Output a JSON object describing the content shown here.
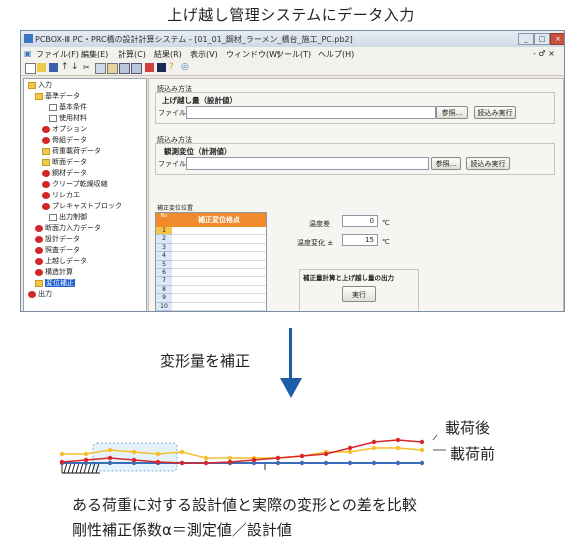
{
  "heading": "上げ越し管理システムにデータ入力",
  "window": {
    "title": "PCBOX-Ⅲ PC・PRC橋の設計計算システム - [01_01_鋼材_ラーメン_橋台_施工_PC.pb2]",
    "menus": [
      "ファイル(F)",
      "編集(E)",
      "計算(C)",
      "結果(R)",
      "表示(V)",
      "ウィンドウ(W)",
      "ツール(T)",
      "ヘルプ(H)"
    ],
    "menu_right": "- ♂ ×",
    "tree": [
      {
        "label": "入力",
        "icon": "folder",
        "level": 0
      },
      {
        "label": "基準データ",
        "icon": "folder",
        "level": 1
      },
      {
        "label": "基本条件",
        "icon": "doc",
        "level": 3
      },
      {
        "label": "使用材料",
        "icon": "doc",
        "level": 3
      },
      {
        "label": "オプション",
        "icon": "red",
        "level": 2
      },
      {
        "label": "骨組データ",
        "icon": "red",
        "level": 2
      },
      {
        "label": "荷重載荷データ",
        "icon": "folder",
        "level": 2
      },
      {
        "label": "断面データ",
        "icon": "folder",
        "level": 2
      },
      {
        "label": "鋼材データ",
        "icon": "red",
        "level": 2
      },
      {
        "label": "クリープ乾燥収縮",
        "icon": "red",
        "level": 2
      },
      {
        "label": "リレカエ",
        "icon": "red",
        "level": 2
      },
      {
        "label": "プレキャストブロック",
        "icon": "red",
        "level": 2
      },
      {
        "label": "出力制御",
        "icon": "doc",
        "level": 3
      },
      {
        "label": "断面力入力データ",
        "icon": "red",
        "level": 1
      },
      {
        "label": "設計データ",
        "icon": "red",
        "level": 1
      },
      {
        "label": "照査データ",
        "icon": "red",
        "level": 1
      },
      {
        "label": "上越しデータ",
        "icon": "red",
        "level": 1
      },
      {
        "label": "構造計算",
        "icon": "red",
        "level": 1
      },
      {
        "label": "変位補正",
        "icon": "folder",
        "level": 1,
        "selected": true
      },
      {
        "label": "出力",
        "icon": "red",
        "level": 0
      }
    ],
    "section1": {
      "caption": "読込み方法",
      "title": "上げ越し量（設計値）",
      "file_label": "ファイル名",
      "browse": "参照...",
      "run": "読込み実行"
    },
    "section2": {
      "caption": "読込み方法",
      "title": "観測変位（計測値）",
      "file_label": "ファイル名",
      "browse": "参照...",
      "run": "読込み実行"
    },
    "grid": {
      "caption": "補正変位位置",
      "corner": "No",
      "header": "補正変位格点",
      "rows": [
        "1",
        "2",
        "3",
        "4",
        "5",
        "6",
        "7",
        "8",
        "9",
        "10"
      ]
    },
    "temp": {
      "label": "温度差",
      "value": "0",
      "unit": "℃"
    },
    "temp_change": {
      "label": "温度変化 ±",
      "value": "15",
      "unit": "℃"
    },
    "calc": {
      "title": "補正量計算と上げ越し量の出力",
      "button": "実行"
    }
  },
  "middle_label": "変形量を補正",
  "legend_after": "載荷後",
  "legend_before": "載荷前",
  "bottom_line1": "ある荷重に対する設計値と実際の変形との差を比較",
  "bottom_line2": "剛性補正係数α＝測定値／設計値",
  "colors": {
    "red_line": "#d7262b",
    "yellow_line": "#f5bf2a",
    "blue_line": "#3a6cb7",
    "arrow": "#1c5ea8"
  }
}
